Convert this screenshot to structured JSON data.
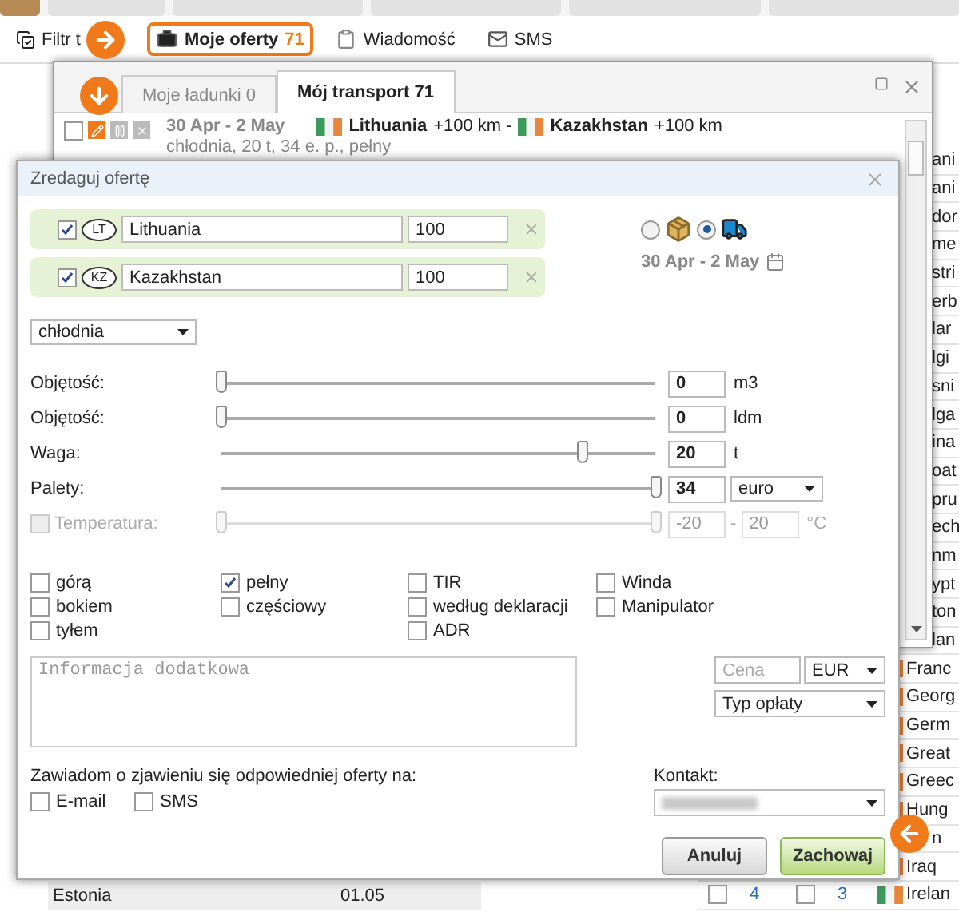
{
  "toolbar": {
    "items": [
      {
        "kind": "filter",
        "label": "Filtr t",
        "selected": false
      },
      {
        "kind": "offers",
        "label": "Moje oferty",
        "count": "71",
        "selected": true
      },
      {
        "kind": "message",
        "label": "Wiadomość",
        "selected": false
      },
      {
        "kind": "sms",
        "label": "SMS",
        "selected": false
      }
    ]
  },
  "country_list": [
    {
      "kind": "clipped",
      "name": "ani"
    },
    {
      "kind": "clipped",
      "name": "ani"
    },
    {
      "kind": "clipped",
      "name": "dor"
    },
    {
      "kind": "clipped",
      "name": "me"
    },
    {
      "kind": "clipped",
      "name": "stri"
    },
    {
      "kind": "clipped",
      "name": "erb"
    },
    {
      "kind": "clipped",
      "name": "lar"
    },
    {
      "kind": "clipped",
      "name": "lgi"
    },
    {
      "kind": "clipped",
      "name": "sni"
    },
    {
      "kind": "clipped",
      "name": "lga"
    },
    {
      "kind": "clipped",
      "name": "ina"
    },
    {
      "kind": "clipped",
      "name": "oat"
    },
    {
      "kind": "clipped",
      "name": "pru"
    },
    {
      "kind": "clipped",
      "name": "ech"
    },
    {
      "kind": "clipped",
      "name": "nm"
    },
    {
      "kind": "clipped",
      "name": "ypt"
    },
    {
      "kind": "clipped",
      "name": "ton"
    },
    {
      "kind": "clipped",
      "name": "lan"
    },
    {
      "kind": "flag",
      "name": "Franc"
    },
    {
      "kind": "flag",
      "name": "Georg"
    },
    {
      "kind": "flag",
      "name": "Germ"
    },
    {
      "kind": "flag",
      "name": "Great"
    },
    {
      "kind": "flag",
      "name": "Greec"
    },
    {
      "kind": "flag",
      "name": "Hung"
    },
    {
      "kind": "clipped",
      "name": "n"
    },
    {
      "kind": "flag",
      "name": "Iraq"
    },
    {
      "kind": "flag",
      "name": "Irelan",
      "cells": [
        {
          "value": "4",
          "checked": false
        },
        {
          "value": "3",
          "checked": false
        }
      ]
    }
  ],
  "left_row": {
    "country": "Estonia",
    "date": "01.05"
  },
  "popup": {
    "tabs": [
      {
        "label": "Moje ładunki 0",
        "selected": false
      },
      {
        "label": "Mój transport 71",
        "selected": true
      }
    ],
    "offer": {
      "checked": false,
      "dates": "30 Apr - 2 May",
      "from": {
        "country": "Lithuania",
        "radius": "+100 km -"
      },
      "to": {
        "country": "Kazakhstan",
        "radius": "+100 km"
      },
      "details": "chłodnia, 20 t, 34 e. p., pełny"
    }
  },
  "dialog": {
    "title": "Zredaguj ofertę",
    "locations": [
      {
        "checked": true,
        "code": "LT",
        "country": "Lithuania",
        "radius": "100"
      },
      {
        "checked": true,
        "code": "KZ",
        "country": "Kazakhstan",
        "radius": "100"
      }
    ],
    "modes": [
      {
        "kind": "cargo",
        "selected": false
      },
      {
        "kind": "truck",
        "selected": true
      }
    ],
    "dates": "30 Apr - 2 May",
    "body_type": "chłodnia",
    "measures": [
      {
        "kind": "slider",
        "label": "Objętość:",
        "level": 0,
        "value": "0",
        "unit": "m3"
      },
      {
        "kind": "slider",
        "label": "Objętość:",
        "level": 0,
        "value": "0",
        "unit": "ldm"
      },
      {
        "kind": "slider",
        "label": "Waga:",
        "level": 0.83,
        "value": "20",
        "unit": "t"
      },
      {
        "kind": "select",
        "label": "Palety:",
        "level": 1,
        "value": "34",
        "unit": "euro"
      },
      {
        "kind": "range",
        "label": "Temperatura:",
        "checked": false,
        "disabled": true,
        "range": [
          {
            "level": 0,
            "value": "-20"
          },
          {
            "level": 1,
            "value": "20"
          }
        ],
        "separator": "-",
        "unit": "°C"
      }
    ],
    "option_columns": [
      {
        "items": [
          {
            "label": "górą",
            "checked": false
          },
          {
            "label": "bokiem",
            "checked": false
          },
          {
            "label": "tyłem",
            "checked": false
          }
        ]
      },
      {
        "items": [
          {
            "label": "pełny",
            "checked": true
          },
          {
            "label": "częściowy",
            "checked": false
          }
        ]
      },
      {
        "items": [
          {
            "label": "TIR",
            "checked": false
          },
          {
            "label": "według deklaracji",
            "checked": false
          },
          {
            "label": "ADR",
            "checked": false
          }
        ]
      },
      {
        "items": [
          {
            "label": "Winda",
            "checked": false
          },
          {
            "label": "Manipulator",
            "checked": false
          }
        ]
      }
    ],
    "notes": {
      "placeholder": "Informacja dodatkowa"
    },
    "price": {
      "placeholder": "Cena"
    },
    "currency": "EUR",
    "payment_type": "Typ opłaty",
    "notify": {
      "label": "Zawiadom o zjawieniu się odpowiedniej oferty na:",
      "channels": [
        {
          "label": "E-mail",
          "checked": false
        },
        {
          "label": "SMS",
          "checked": false
        }
      ]
    },
    "contact": {
      "label": "Kontakt:"
    },
    "buttons": [
      {
        "kind": "cancel",
        "label": "Anuluj"
      },
      {
        "kind": "save",
        "label": "Zachowaj"
      }
    ]
  }
}
